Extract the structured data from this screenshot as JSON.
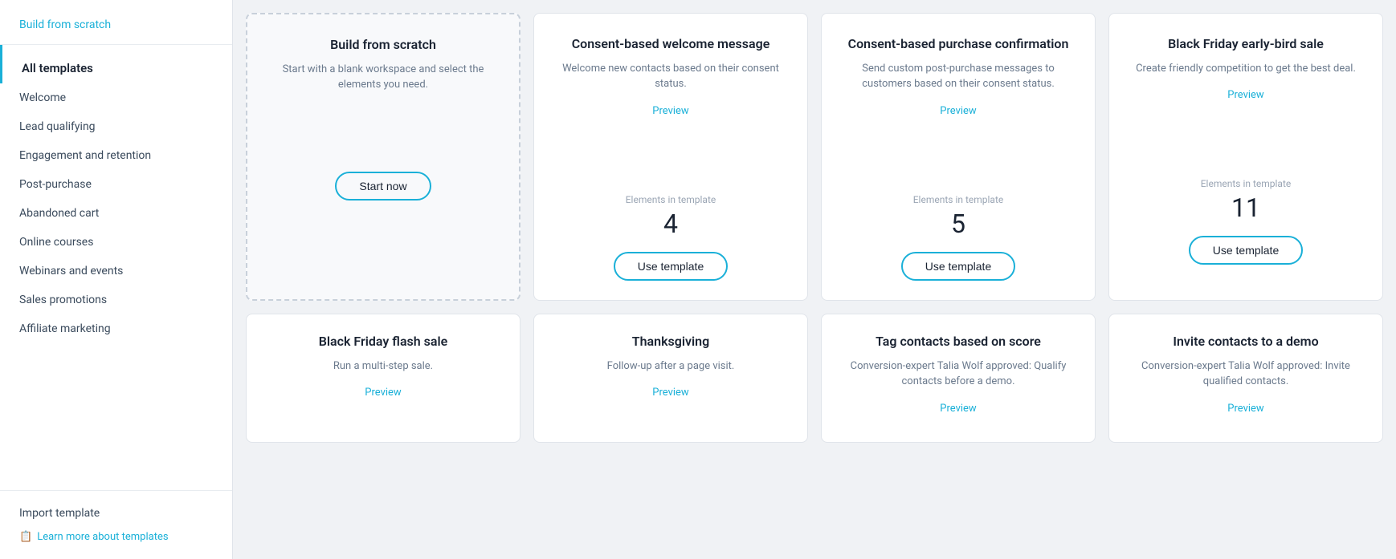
{
  "sidebar": {
    "build_from_scratch_link": "Build from scratch",
    "all_templates_label": "All templates",
    "nav_items": [
      {
        "label": "Welcome"
      },
      {
        "label": "Lead qualifying"
      },
      {
        "label": "Engagement and retention"
      },
      {
        "label": "Post-purchase"
      },
      {
        "label": "Abandoned cart"
      },
      {
        "label": "Online courses"
      },
      {
        "label": "Webinars and events"
      },
      {
        "label": "Sales promotions"
      },
      {
        "label": "Affiliate marketing"
      }
    ],
    "import_template": "Import template",
    "learn_more": "Learn more about templates"
  },
  "top_row_cards": [
    {
      "id": "build-from-scratch",
      "title": "Build from scratch",
      "description": "Start with a blank workspace and select the elements you need.",
      "btn_label": "Start now",
      "icon": "scratch",
      "is_scratch": true
    },
    {
      "id": "consent-welcome",
      "title": "Consent-based welcome message",
      "description": "Welcome new contacts based on their consent status.",
      "preview_label": "Preview",
      "elements_label": "Elements in template",
      "elements_count": "4",
      "btn_label": "Use template",
      "icon": "smiley"
    },
    {
      "id": "consent-purchase",
      "title": "Consent-based purchase confirmation",
      "description": "Send custom post-purchase messages to customers based on their consent status.",
      "preview_label": "Preview",
      "elements_label": "Elements in template",
      "elements_count": "5",
      "btn_label": "Use template",
      "icon": "basket"
    },
    {
      "id": "black-friday-earlybird",
      "title": "Black Friday early-bird sale",
      "description": "Create friendly competition to get the best deal.",
      "preview_label": "Preview",
      "elements_label": "Elements in template",
      "elements_count": "11",
      "btn_label": "Use template",
      "icon": "wallet"
    }
  ],
  "bottom_row_cards": [
    {
      "id": "black-friday-flash",
      "title": "Black Friday flash sale",
      "description": "Run a multi-step sale.",
      "preview_label": "Preview"
    },
    {
      "id": "thanksgiving",
      "title": "Thanksgiving",
      "description": "Follow-up after a page visit.",
      "preview_label": "Preview"
    },
    {
      "id": "tag-contacts",
      "title": "Tag contacts based on score",
      "description": "Conversion-expert Talia Wolf approved: Qualify contacts before a demo.",
      "preview_label": "Preview"
    },
    {
      "id": "invite-demo",
      "title": "Invite contacts to a demo",
      "description": "Conversion-expert Talia Wolf approved: Invite qualified contacts.",
      "preview_label": "Preview"
    }
  ]
}
